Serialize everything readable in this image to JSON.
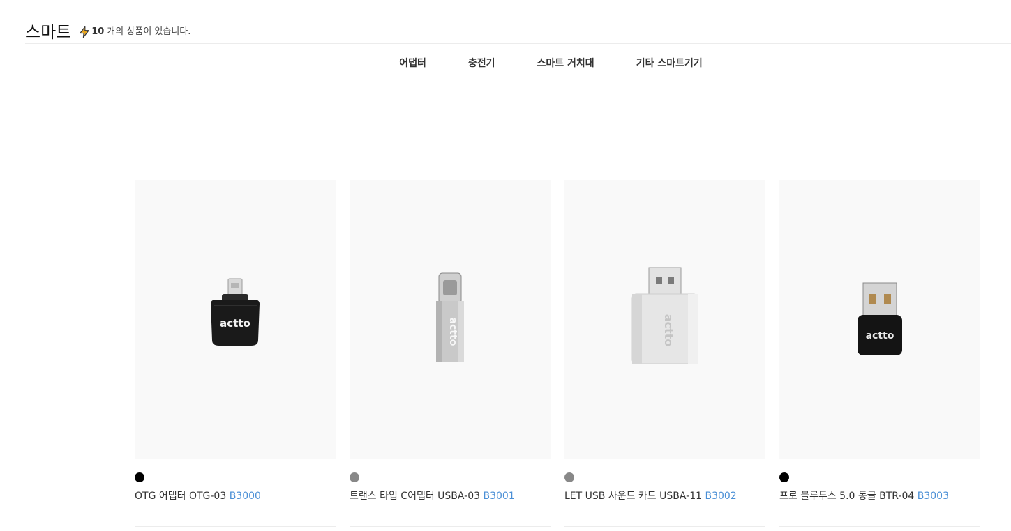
{
  "header": {
    "title": "스마트",
    "count": "10",
    "count_suffix": "개의 상품이 있습니다.",
    "bolt_color": "#e8a317"
  },
  "nav": {
    "items": [
      {
        "label": "어댑터"
      },
      {
        "label": "충전기"
      },
      {
        "label": "스마트 거치대"
      },
      {
        "label": "기타 스마트기기"
      }
    ]
  },
  "products": [
    {
      "name": "OTG 어댑터 OTG-03 ",
      "code": "B3000",
      "swatch": "#000000",
      "brand": "actto",
      "icon": "otg-adapter-image"
    },
    {
      "name": "트랜스 타입 C어댑터 USBA-03 ",
      "code": "B3001",
      "swatch": "#888888",
      "brand": "actto",
      "icon": "type-c-adapter-image"
    },
    {
      "name": "LET USB 사운드 카드 USBA-11 ",
      "code": "B3002",
      "swatch": "#888888",
      "brand": "actto",
      "icon": "usb-sound-card-image"
    },
    {
      "name": "프로 블루투스 5.0 동글 BTR-04 ",
      "code": "B3003",
      "swatch": "#000000",
      "brand": "actto",
      "icon": "bluetooth-dongle-image"
    }
  ],
  "colors": {
    "accent_link": "#4a8fd6",
    "thumb_bg": "#f9f9f9"
  }
}
